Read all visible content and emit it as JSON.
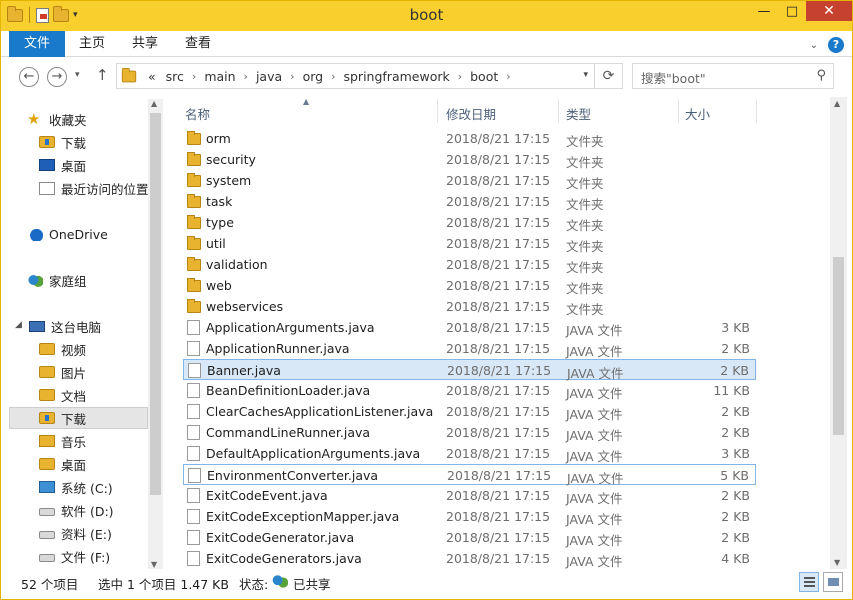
{
  "window": {
    "title": "boot"
  },
  "ribbon": {
    "tabs": [
      "文件",
      "主页",
      "共享",
      "查看"
    ]
  },
  "address": {
    "crumb_prefix": "«",
    "crumbs": [
      "src",
      "main",
      "java",
      "org",
      "springframework",
      "boot"
    ],
    "search_placeholder": "搜索\"boot\""
  },
  "nav": {
    "items": [
      {
        "label": "收藏夹",
        "icon": "star-icon"
      },
      {
        "label": "下载",
        "icon": "downloads-folder-icon"
      },
      {
        "label": "桌面",
        "icon": "desktop-icon"
      },
      {
        "label": "最近访问的位置",
        "icon": "recent-places-icon"
      },
      {
        "label": "OneDrive",
        "icon": "onedrive-icon"
      },
      {
        "label": "家庭组",
        "icon": "homegroup-icon"
      },
      {
        "label": "这台电脑",
        "icon": "this-pc-icon"
      },
      {
        "label": "视频",
        "icon": "videos-folder-icon"
      },
      {
        "label": "图片",
        "icon": "pictures-folder-icon"
      },
      {
        "label": "文档",
        "icon": "documents-folder-icon"
      },
      {
        "label": "下载",
        "icon": "downloads-folder-icon"
      },
      {
        "label": "音乐",
        "icon": "music-folder-icon"
      },
      {
        "label": "桌面",
        "icon": "desktop-folder-icon"
      },
      {
        "label": "系统 (C:)",
        "icon": "system-drive-icon"
      },
      {
        "label": "软件 (D:)",
        "icon": "drive-icon"
      },
      {
        "label": "资料 (E:)",
        "icon": "drive-icon"
      },
      {
        "label": "文件 (F:)",
        "icon": "drive-icon"
      }
    ]
  },
  "columns": {
    "name": "名称",
    "date": "修改日期",
    "type": "类型",
    "size": "大小"
  },
  "files": [
    {
      "name": "orm",
      "date": "2018/8/21 17:15",
      "type": "文件夹",
      "size": "",
      "kind": "folder"
    },
    {
      "name": "security",
      "date": "2018/8/21 17:15",
      "type": "文件夹",
      "size": "",
      "kind": "folder"
    },
    {
      "name": "system",
      "date": "2018/8/21 17:15",
      "type": "文件夹",
      "size": "",
      "kind": "folder"
    },
    {
      "name": "task",
      "date": "2018/8/21 17:15",
      "type": "文件夹",
      "size": "",
      "kind": "folder"
    },
    {
      "name": "type",
      "date": "2018/8/21 17:15",
      "type": "文件夹",
      "size": "",
      "kind": "folder"
    },
    {
      "name": "util",
      "date": "2018/8/21 17:15",
      "type": "文件夹",
      "size": "",
      "kind": "folder"
    },
    {
      "name": "validation",
      "date": "2018/8/21 17:15",
      "type": "文件夹",
      "size": "",
      "kind": "folder"
    },
    {
      "name": "web",
      "date": "2018/8/21 17:15",
      "type": "文件夹",
      "size": "",
      "kind": "folder"
    },
    {
      "name": "webservices",
      "date": "2018/8/21 17:15",
      "type": "文件夹",
      "size": "",
      "kind": "folder"
    },
    {
      "name": "ApplicationArguments.java",
      "date": "2018/8/21 17:15",
      "type": "JAVA 文件",
      "size": "3 KB",
      "kind": "file"
    },
    {
      "name": "ApplicationRunner.java",
      "date": "2018/8/21 17:15",
      "type": "JAVA 文件",
      "size": "2 KB",
      "kind": "file"
    },
    {
      "name": "Banner.java",
      "date": "2018/8/21 17:15",
      "type": "JAVA 文件",
      "size": "2 KB",
      "kind": "file",
      "state": "selected"
    },
    {
      "name": "BeanDefinitionLoader.java",
      "date": "2018/8/21 17:15",
      "type": "JAVA 文件",
      "size": "11 KB",
      "kind": "file"
    },
    {
      "name": "ClearCachesApplicationListener.java",
      "date": "2018/8/21 17:15",
      "type": "JAVA 文件",
      "size": "2 KB",
      "kind": "file"
    },
    {
      "name": "CommandLineRunner.java",
      "date": "2018/8/21 17:15",
      "type": "JAVA 文件",
      "size": "2 KB",
      "kind": "file"
    },
    {
      "name": "DefaultApplicationArguments.java",
      "date": "2018/8/21 17:15",
      "type": "JAVA 文件",
      "size": "3 KB",
      "kind": "file"
    },
    {
      "name": "EnvironmentConverter.java",
      "date": "2018/8/21 17:15",
      "type": "JAVA 文件",
      "size": "5 KB",
      "kind": "file",
      "state": "focused"
    },
    {
      "name": "ExitCodeEvent.java",
      "date": "2018/8/21 17:15",
      "type": "JAVA 文件",
      "size": "2 KB",
      "kind": "file"
    },
    {
      "name": "ExitCodeExceptionMapper.java",
      "date": "2018/8/21 17:15",
      "type": "JAVA 文件",
      "size": "2 KB",
      "kind": "file"
    },
    {
      "name": "ExitCodeGenerator.java",
      "date": "2018/8/21 17:15",
      "type": "JAVA 文件",
      "size": "2 KB",
      "kind": "file"
    },
    {
      "name": "ExitCodeGenerators.java",
      "date": "2018/8/21 17:15",
      "type": "JAVA 文件",
      "size": "4 KB",
      "kind": "file"
    }
  ],
  "status": {
    "count": "52 个项目",
    "selection": "选中 1 个项目  1.47 KB",
    "state_label": "状态:",
    "state_value": "已共享"
  },
  "colors": {
    "title_bar": "#f9cf2d",
    "file_tab": "#1979ca",
    "selection": "#d9e8f7"
  }
}
